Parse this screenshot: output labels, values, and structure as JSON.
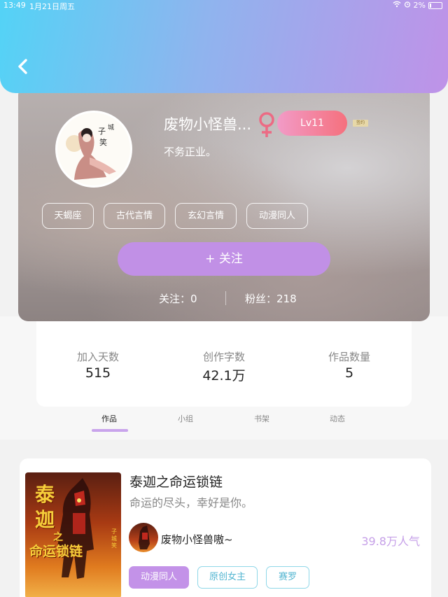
{
  "status_bar": {
    "time": "13:49",
    "date": "1月21日周五",
    "battery": "2%"
  },
  "profile": {
    "nickname": "废物小怪兽...",
    "gender_symbol": "♀",
    "level": "Lv11",
    "sign_badge": "签约",
    "bio": "不务正业。",
    "tags": [
      "天蝎座",
      "古代言情",
      "玄幻言情",
      "动漫同人"
    ],
    "follow_button": "+  关注",
    "following": "关注：0",
    "fans": "粉丝：218",
    "avatar_text": {
      "a": "子",
      "b": "城",
      "c": "笑"
    }
  },
  "stats": [
    {
      "label": "加入天数",
      "value": "515"
    },
    {
      "label": "创作字数",
      "value": "42.1万"
    },
    {
      "label": "作品数量",
      "value": "5"
    }
  ],
  "tabs": [
    "作品",
    "小组",
    "书架",
    "动态"
  ],
  "active_tab": "作品",
  "work": {
    "title": "泰迦之命运锁链",
    "description": "命运的尽头，幸好是你。",
    "author": "废物小怪兽嗷~",
    "popularity": "39.8万人气",
    "tags": [
      "动漫同人",
      "原创女主",
      "赛罗"
    ],
    "cover_text": {
      "t1": "泰",
      "t2": "迦",
      "t3": "之",
      "t4": "命运锁链",
      "t5": "子城笑"
    }
  },
  "colors": {
    "accent": "#c190e6",
    "header_start": "#53d3f6",
    "header_end": "#bf92e8",
    "popularity": "#c6a0e8"
  }
}
